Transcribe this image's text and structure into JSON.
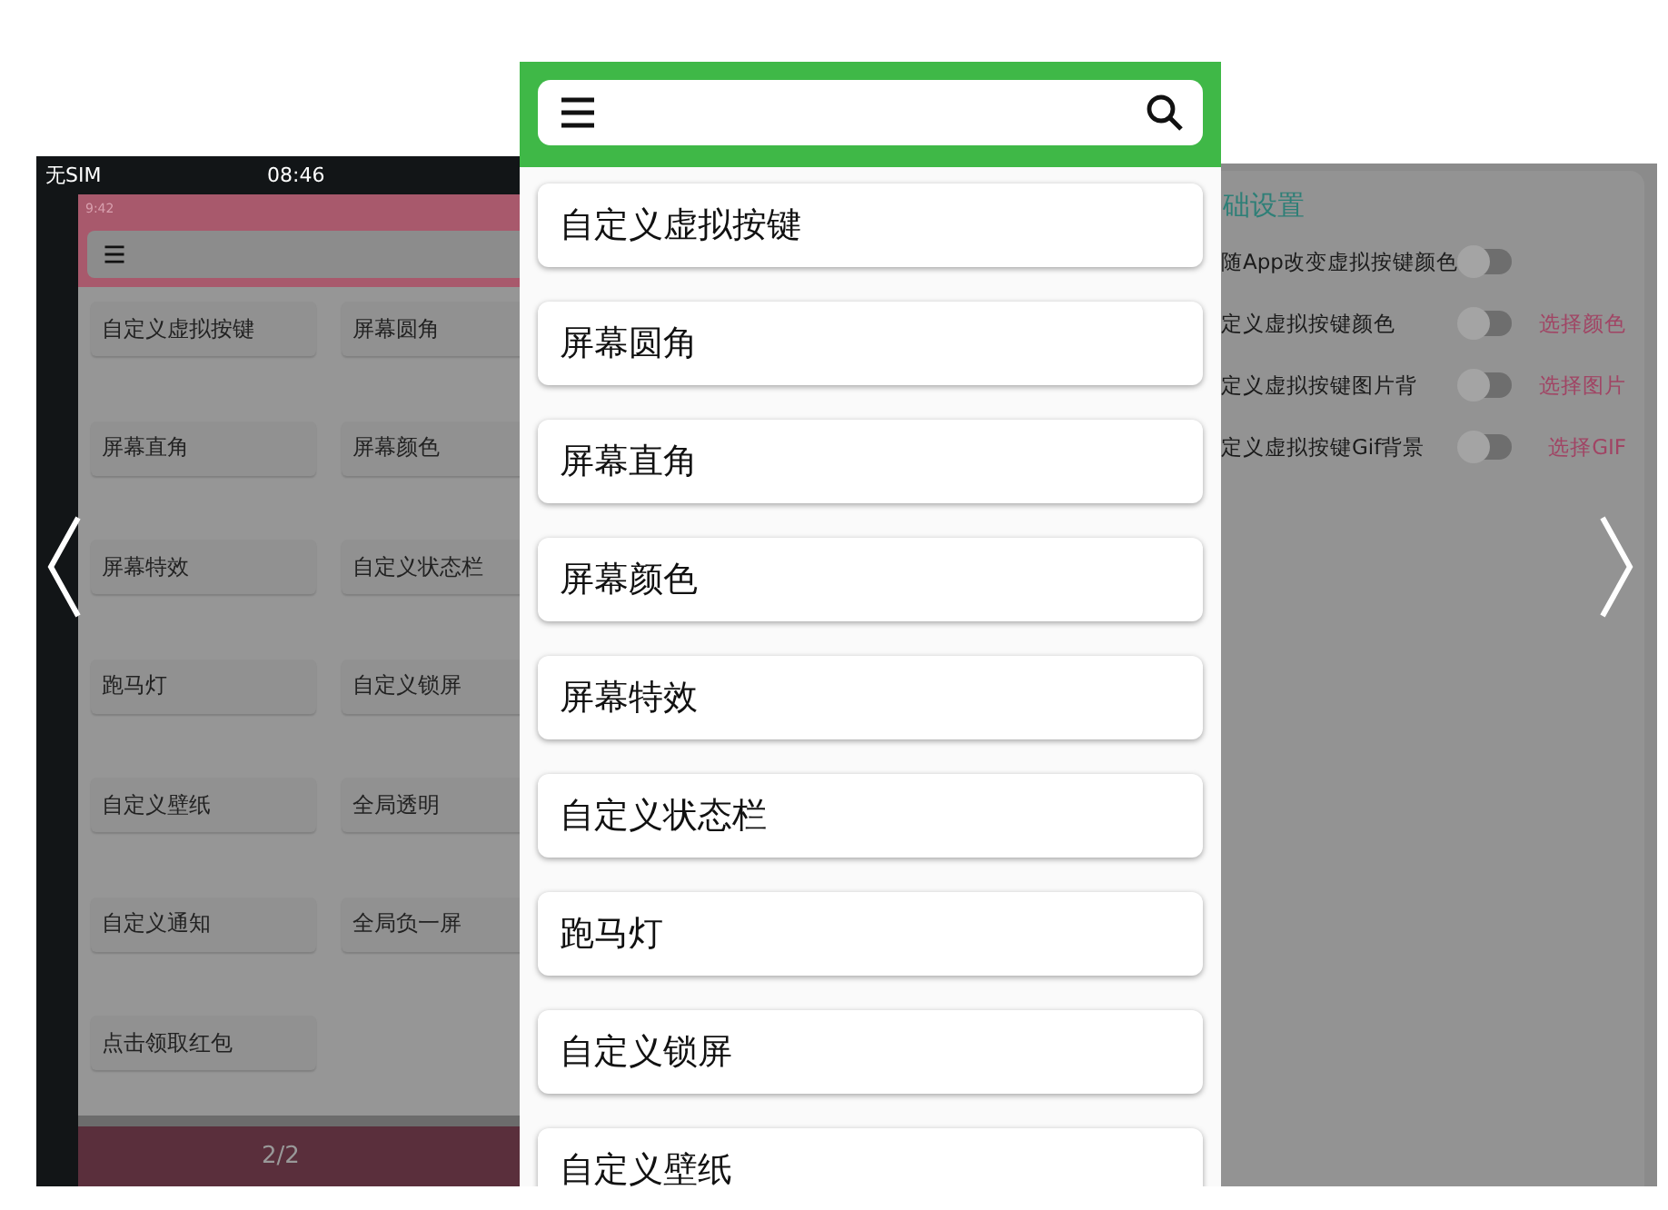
{
  "left_screenshot": {
    "status_bar": {
      "carrier": "无SIM",
      "time": "08:46"
    },
    "app_status_time": "9:42",
    "grid_items": [
      "自定义虚拟按键",
      "屏幕圆角",
      "屏幕直角",
      "屏幕颜色",
      "屏幕特效",
      "自定义状态栏",
      "跑马灯",
      "自定义锁屏",
      "自定义壁纸",
      "全局透明",
      "自定义通知",
      "全局负一屏",
      "点击领取红包"
    ],
    "page_indicator": "2/2"
  },
  "center_screenshot": {
    "items": [
      "自定义虚拟按键",
      "屏幕圆角",
      "屏幕直角",
      "屏幕颜色",
      "屏幕特效",
      "自定义状态栏",
      "跑马灯",
      "自定义锁屏",
      "自定义壁纸"
    ]
  },
  "right_screenshot": {
    "section_title": "础设置",
    "settings": [
      {
        "label": "随App改变虚拟按键颜色",
        "on": false
      },
      {
        "label": "定义虚拟按键颜色",
        "on": false,
        "action": "选择颜色"
      },
      {
        "label": "定义虚拟按键图片背",
        "on": false,
        "action": "选择图片"
      },
      {
        "label": "定义虚拟按键Gif背景",
        "on": false,
        "action": "选择GIF"
      }
    ]
  }
}
